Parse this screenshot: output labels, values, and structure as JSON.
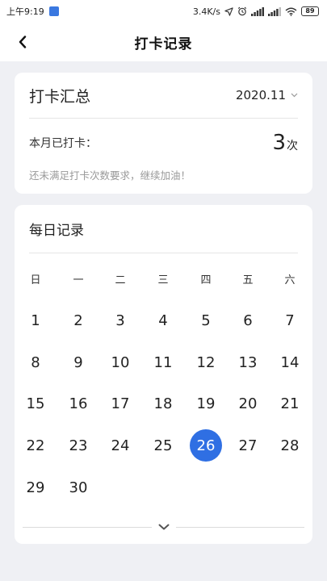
{
  "status_bar": {
    "time": "上午9:19",
    "speed": "3.4K/s",
    "battery": "89"
  },
  "header": {
    "title": "打卡记录"
  },
  "summary": {
    "title": "打卡汇总",
    "month": "2020.11",
    "count_label": "本月已打卡：",
    "count_value": "3",
    "count_unit": "次",
    "hint": "还未满足打卡次数要求，继续加油！"
  },
  "daily": {
    "title": "每日记录",
    "weekdays": [
      "日",
      "一",
      "二",
      "三",
      "四",
      "五",
      "六"
    ],
    "days": [
      "1",
      "2",
      "3",
      "4",
      "5",
      "6",
      "7",
      "8",
      "9",
      "10",
      "11",
      "12",
      "13",
      "14",
      "15",
      "16",
      "17",
      "18",
      "19",
      "20",
      "21",
      "22",
      "23",
      "24",
      "25",
      "26",
      "27",
      "28",
      "29",
      "30"
    ],
    "selected_day": "26"
  },
  "icons": {
    "back": "chevron-left-icon",
    "month_dropdown": "chevron-down-icon",
    "expand": "chevron-down-icon",
    "app": "app-notification-icon",
    "location": "location-arrow-icon",
    "alarm": "alarm-clock-icon",
    "signal": "signal-icon",
    "wifi": "wifi-icon",
    "battery": "battery-icon"
  },
  "colors": {
    "accent": "#2f6fe3",
    "background": "#eff0f4",
    "card": "#ffffff",
    "hint": "#999999"
  }
}
